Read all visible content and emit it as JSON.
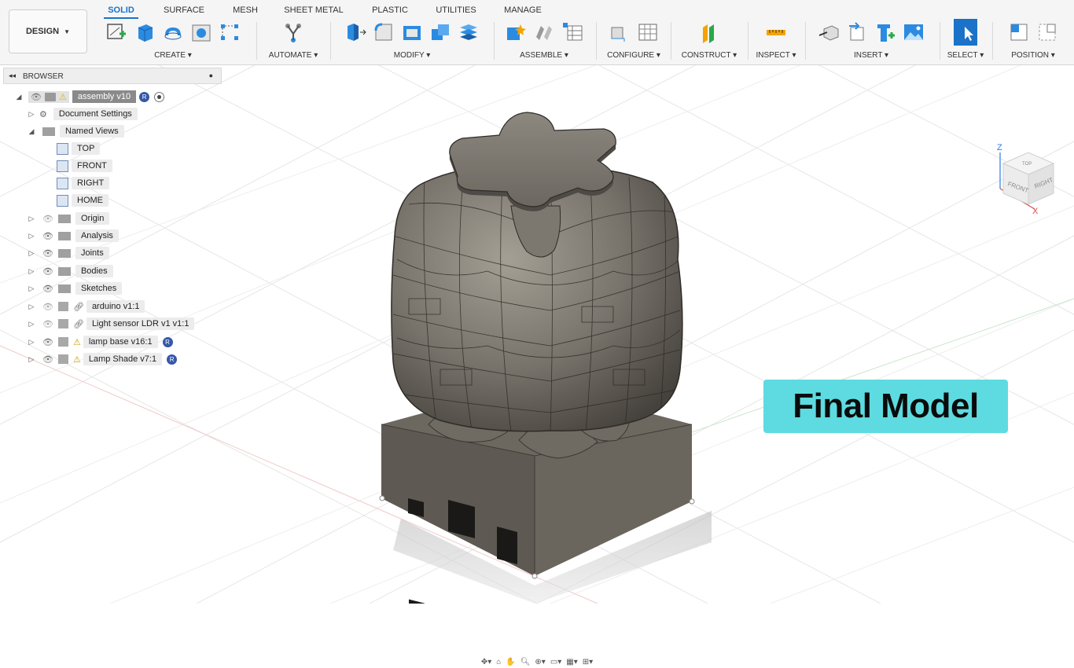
{
  "toolbar": {
    "workspace": "DESIGN",
    "tabs": [
      "SOLID",
      "SURFACE",
      "MESH",
      "SHEET METAL",
      "PLASTIC",
      "UTILITIES",
      "MANAGE"
    ],
    "active_tab": "SOLID",
    "groups": {
      "create": "CREATE ▾",
      "automate": "AUTOMATE ▾",
      "modify": "MODIFY ▾",
      "assemble": "ASSEMBLE ▾",
      "configure": "CONFIGURE ▾",
      "construct": "CONSTRUCT ▾",
      "inspect": "INSPECT ▾",
      "insert": "INSERT ▾",
      "select": "SELECT ▾",
      "position": "POSITION ▾"
    },
    "accent_color": "#1a73c8"
  },
  "browser": {
    "title": "BROWSER",
    "root": "assembly v10",
    "document_settings": "Document Settings",
    "named_views": "Named Views",
    "views": [
      "TOP",
      "FRONT",
      "RIGHT",
      "HOME"
    ],
    "folders": [
      "Origin",
      "Analysis",
      "Joints",
      "Bodies",
      "Sketches"
    ],
    "components": [
      "arduino v1:1",
      "Light sensor LDR v1 v1:1",
      "lamp base v16:1",
      "Lamp Shade v7:1"
    ]
  },
  "viewport": {
    "overlay_text": "Final Model",
    "overlay_color": "#5ddbe0",
    "viewcube": {
      "top": "TOP",
      "front": "FRONT",
      "right": "RIGHT",
      "axis_z": "Z",
      "axis_x": "X"
    }
  }
}
